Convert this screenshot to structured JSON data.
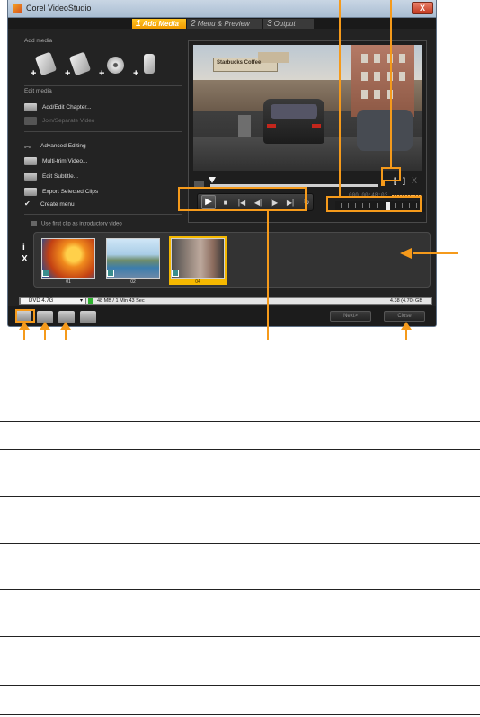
{
  "window": {
    "title": "Corel VideoStudio",
    "close_label": "X"
  },
  "tabs": [
    {
      "num": "1",
      "label": "Add Media"
    },
    {
      "num": "2",
      "label": "Menu & Preview"
    },
    {
      "num": "3",
      "label": "Output"
    }
  ],
  "left_panel": {
    "add_media_heading": "Add media",
    "media_icons": [
      "add-video-icon",
      "add-vr-icon",
      "add-disc-icon",
      "add-device-icon"
    ],
    "edit_media_heading": "Edit media",
    "add_edit_chapter": "Add/Edit Chapter...",
    "join_separate_video": "Join/Separate Video",
    "advanced_editing": "Advanced Editing",
    "multi_trim_video": "Multi-trim Video...",
    "edit_subtitle": "Edit Subtitle...",
    "export_selected_clips": "Export Selected Clips",
    "create_menu": "Create menu",
    "use_first_clip": "Use first clip as introductory video"
  },
  "preview": {
    "video_sign_text": "Starbucks Coffee",
    "timecode": "000:00:48:03",
    "mark_in": "[",
    "mark_out": "]",
    "delete": "X"
  },
  "controls": [
    "play",
    "stop",
    "go-to-start",
    "previous-frame",
    "next-frame",
    "go-to-end",
    "repeat"
  ],
  "clips": [
    {
      "label": "01"
    },
    {
      "label": "02"
    },
    {
      "label": "04"
    }
  ],
  "filmstrip": {
    "info_label": "i",
    "remove_label": "X"
  },
  "bottom": {
    "disc_type": "DVD 4.7G",
    "used_size": "48 MB / 1 Min 43 Sec",
    "capacity": "4.38 (4.70) GB",
    "used_fraction": 0.01,
    "next_label": "Next>",
    "close_label": "Close"
  },
  "colors": {
    "accent": "#f59a1b",
    "tab_active": "#f5b800",
    "selected_clip": "#f5b800"
  }
}
